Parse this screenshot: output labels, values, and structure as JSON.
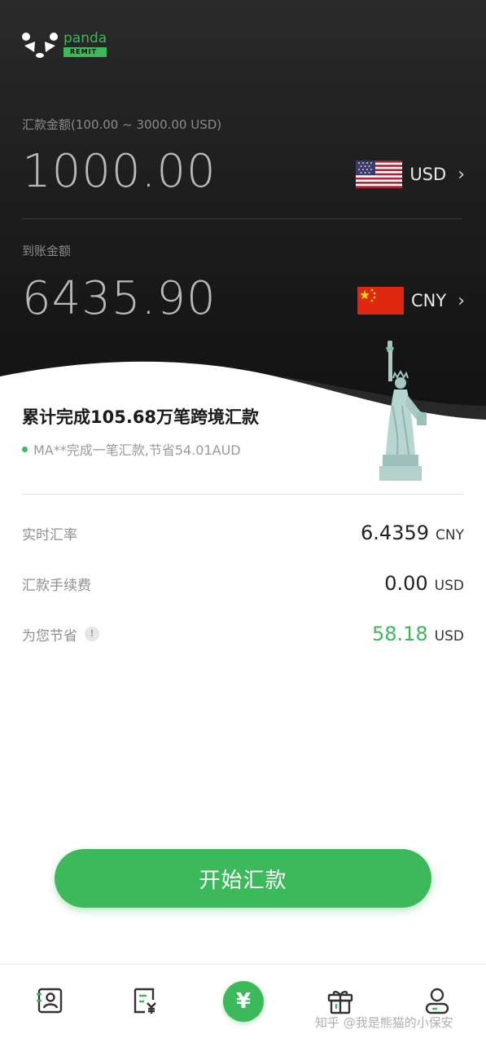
{
  "brand": {
    "name": "panda",
    "badge": "REMIT"
  },
  "send": {
    "label": "汇款金额(100.00 ~ 3000.00 USD)",
    "amount": "1000.00",
    "currency": "USD"
  },
  "receive": {
    "label": "到账金额",
    "amount": "6435.90",
    "currency": "CNY"
  },
  "stats": {
    "title": "累计完成105.68万笔跨境汇款",
    "ticker": "MA**完成一笔汇款,节省54.01AUD"
  },
  "details": [
    {
      "label": "实时汇率",
      "value": "6.4359",
      "unit": "CNY"
    },
    {
      "label": "汇款手续费",
      "value": "0.00",
      "unit": "USD"
    },
    {
      "label": "为您节省",
      "value": "58.18",
      "unit": "USD"
    }
  ],
  "info_glyph": "!",
  "cta": {
    "label": "开始汇款"
  },
  "tabs": [
    {
      "icon": "contacts-icon"
    },
    {
      "icon": "bill-icon"
    },
    {
      "icon": "remit-icon",
      "glyph": "¥"
    },
    {
      "icon": "gift-icon"
    },
    {
      "icon": "profile-icon"
    }
  ],
  "watermark": "知乎 @我是熊猫的小保安",
  "colors": {
    "accent": "#3cb95a",
    "hero_bg": "#1c1c1c"
  }
}
